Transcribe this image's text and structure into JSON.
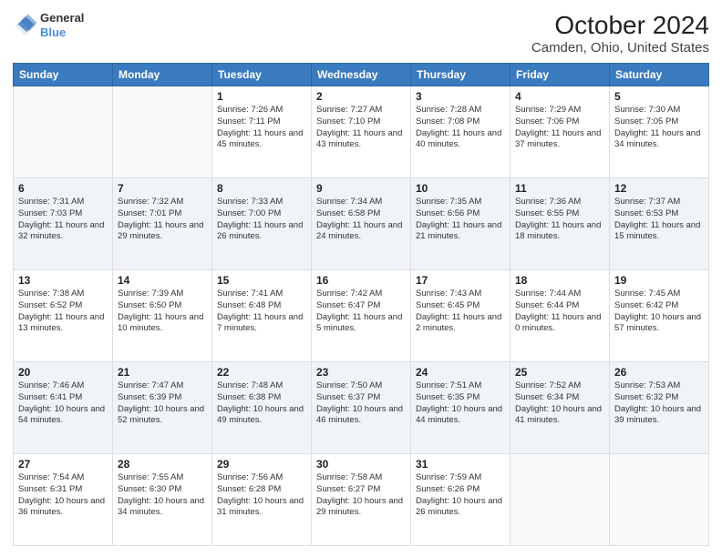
{
  "header": {
    "logo": {
      "line1": "General",
      "line2": "Blue"
    },
    "title": "October 2024",
    "subtitle": "Camden, Ohio, United States"
  },
  "days_of_week": [
    "Sunday",
    "Monday",
    "Tuesday",
    "Wednesday",
    "Thursday",
    "Friday",
    "Saturday"
  ],
  "weeks": [
    [
      {
        "day": "",
        "sunrise": "",
        "sunset": "",
        "daylight": ""
      },
      {
        "day": "",
        "sunrise": "",
        "sunset": "",
        "daylight": ""
      },
      {
        "day": "1",
        "sunrise": "Sunrise: 7:26 AM",
        "sunset": "Sunset: 7:11 PM",
        "daylight": "Daylight: 11 hours and 45 minutes."
      },
      {
        "day": "2",
        "sunrise": "Sunrise: 7:27 AM",
        "sunset": "Sunset: 7:10 PM",
        "daylight": "Daylight: 11 hours and 43 minutes."
      },
      {
        "day": "3",
        "sunrise": "Sunrise: 7:28 AM",
        "sunset": "Sunset: 7:08 PM",
        "daylight": "Daylight: 11 hours and 40 minutes."
      },
      {
        "day": "4",
        "sunrise": "Sunrise: 7:29 AM",
        "sunset": "Sunset: 7:06 PM",
        "daylight": "Daylight: 11 hours and 37 minutes."
      },
      {
        "day": "5",
        "sunrise": "Sunrise: 7:30 AM",
        "sunset": "Sunset: 7:05 PM",
        "daylight": "Daylight: 11 hours and 34 minutes."
      }
    ],
    [
      {
        "day": "6",
        "sunrise": "Sunrise: 7:31 AM",
        "sunset": "Sunset: 7:03 PM",
        "daylight": "Daylight: 11 hours and 32 minutes."
      },
      {
        "day": "7",
        "sunrise": "Sunrise: 7:32 AM",
        "sunset": "Sunset: 7:01 PM",
        "daylight": "Daylight: 11 hours and 29 minutes."
      },
      {
        "day": "8",
        "sunrise": "Sunrise: 7:33 AM",
        "sunset": "Sunset: 7:00 PM",
        "daylight": "Daylight: 11 hours and 26 minutes."
      },
      {
        "day": "9",
        "sunrise": "Sunrise: 7:34 AM",
        "sunset": "Sunset: 6:58 PM",
        "daylight": "Daylight: 11 hours and 24 minutes."
      },
      {
        "day": "10",
        "sunrise": "Sunrise: 7:35 AM",
        "sunset": "Sunset: 6:56 PM",
        "daylight": "Daylight: 11 hours and 21 minutes."
      },
      {
        "day": "11",
        "sunrise": "Sunrise: 7:36 AM",
        "sunset": "Sunset: 6:55 PM",
        "daylight": "Daylight: 11 hours and 18 minutes."
      },
      {
        "day": "12",
        "sunrise": "Sunrise: 7:37 AM",
        "sunset": "Sunset: 6:53 PM",
        "daylight": "Daylight: 11 hours and 15 minutes."
      }
    ],
    [
      {
        "day": "13",
        "sunrise": "Sunrise: 7:38 AM",
        "sunset": "Sunset: 6:52 PM",
        "daylight": "Daylight: 11 hours and 13 minutes."
      },
      {
        "day": "14",
        "sunrise": "Sunrise: 7:39 AM",
        "sunset": "Sunset: 6:50 PM",
        "daylight": "Daylight: 11 hours and 10 minutes."
      },
      {
        "day": "15",
        "sunrise": "Sunrise: 7:41 AM",
        "sunset": "Sunset: 6:48 PM",
        "daylight": "Daylight: 11 hours and 7 minutes."
      },
      {
        "day": "16",
        "sunrise": "Sunrise: 7:42 AM",
        "sunset": "Sunset: 6:47 PM",
        "daylight": "Daylight: 11 hours and 5 minutes."
      },
      {
        "day": "17",
        "sunrise": "Sunrise: 7:43 AM",
        "sunset": "Sunset: 6:45 PM",
        "daylight": "Daylight: 11 hours and 2 minutes."
      },
      {
        "day": "18",
        "sunrise": "Sunrise: 7:44 AM",
        "sunset": "Sunset: 6:44 PM",
        "daylight": "Daylight: 11 hours and 0 minutes."
      },
      {
        "day": "19",
        "sunrise": "Sunrise: 7:45 AM",
        "sunset": "Sunset: 6:42 PM",
        "daylight": "Daylight: 10 hours and 57 minutes."
      }
    ],
    [
      {
        "day": "20",
        "sunrise": "Sunrise: 7:46 AM",
        "sunset": "Sunset: 6:41 PM",
        "daylight": "Daylight: 10 hours and 54 minutes."
      },
      {
        "day": "21",
        "sunrise": "Sunrise: 7:47 AM",
        "sunset": "Sunset: 6:39 PM",
        "daylight": "Daylight: 10 hours and 52 minutes."
      },
      {
        "day": "22",
        "sunrise": "Sunrise: 7:48 AM",
        "sunset": "Sunset: 6:38 PM",
        "daylight": "Daylight: 10 hours and 49 minutes."
      },
      {
        "day": "23",
        "sunrise": "Sunrise: 7:50 AM",
        "sunset": "Sunset: 6:37 PM",
        "daylight": "Daylight: 10 hours and 46 minutes."
      },
      {
        "day": "24",
        "sunrise": "Sunrise: 7:51 AM",
        "sunset": "Sunset: 6:35 PM",
        "daylight": "Daylight: 10 hours and 44 minutes."
      },
      {
        "day": "25",
        "sunrise": "Sunrise: 7:52 AM",
        "sunset": "Sunset: 6:34 PM",
        "daylight": "Daylight: 10 hours and 41 minutes."
      },
      {
        "day": "26",
        "sunrise": "Sunrise: 7:53 AM",
        "sunset": "Sunset: 6:32 PM",
        "daylight": "Daylight: 10 hours and 39 minutes."
      }
    ],
    [
      {
        "day": "27",
        "sunrise": "Sunrise: 7:54 AM",
        "sunset": "Sunset: 6:31 PM",
        "daylight": "Daylight: 10 hours and 36 minutes."
      },
      {
        "day": "28",
        "sunrise": "Sunrise: 7:55 AM",
        "sunset": "Sunset: 6:30 PM",
        "daylight": "Daylight: 10 hours and 34 minutes."
      },
      {
        "day": "29",
        "sunrise": "Sunrise: 7:56 AM",
        "sunset": "Sunset: 6:28 PM",
        "daylight": "Daylight: 10 hours and 31 minutes."
      },
      {
        "day": "30",
        "sunrise": "Sunrise: 7:58 AM",
        "sunset": "Sunset: 6:27 PM",
        "daylight": "Daylight: 10 hours and 29 minutes."
      },
      {
        "day": "31",
        "sunrise": "Sunrise: 7:59 AM",
        "sunset": "Sunset: 6:26 PM",
        "daylight": "Daylight: 10 hours and 26 minutes."
      },
      {
        "day": "",
        "sunrise": "",
        "sunset": "",
        "daylight": ""
      },
      {
        "day": "",
        "sunrise": "",
        "sunset": "",
        "daylight": ""
      }
    ]
  ]
}
